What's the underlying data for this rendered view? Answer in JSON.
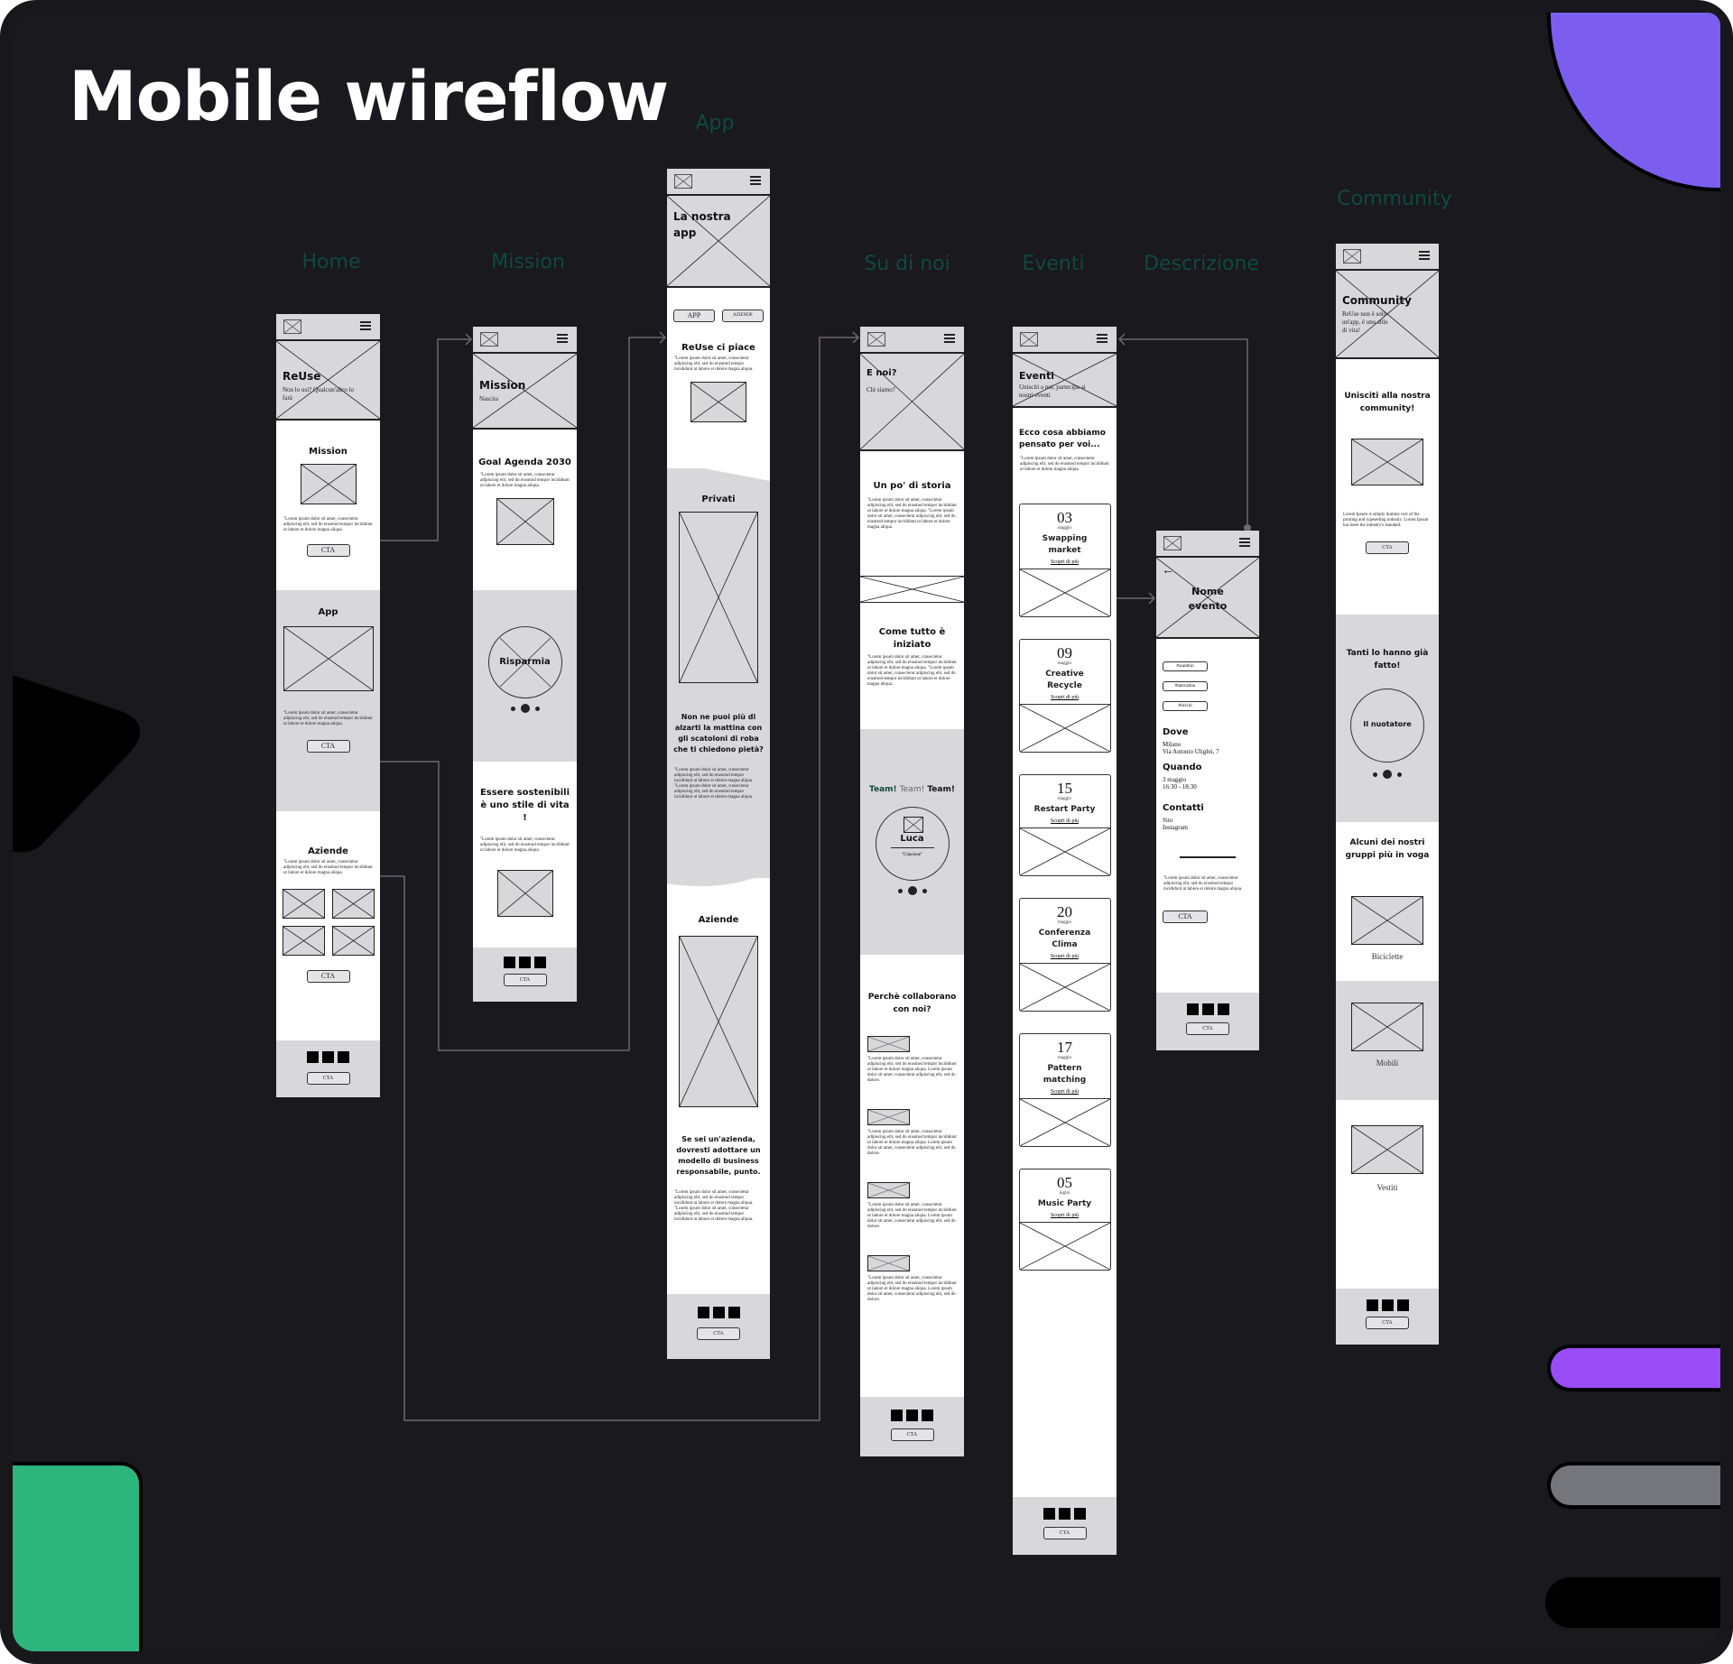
{
  "board": {
    "title": "Mobile wireflow",
    "colors": {
      "background": "#1a191d",
      "label": "#0f4a3c",
      "purple_corner": "#7b5ef0",
      "purple_pill": "#9a4cf6",
      "gray_pill": "#75767c",
      "green_block": "#2db57e"
    }
  },
  "flow_labels": {
    "home": "Home",
    "mission": "Mission",
    "app": "App",
    "su_di_noi": "Su di noi",
    "eventi": "Eventi",
    "descrizione": "Descrizione",
    "community": "Community"
  },
  "common": {
    "cta": "CTA",
    "lorem": "\"Lorem ipsum dolor sit amet, consectetur adipiscing elit, sed do eiusmod tempor incididunt ut labore et dolore magna aliqua.",
    "lorem_long": "\"Lorem ipsum dolor sit amet, consectetur adipiscing elit, sed do eiusmod tempor incididunt ut labore et dolore magna aliqua. \"Lorem ipsum dolor sit amet, consectetur adipiscing elit, sed do eiusmod tempor incididunt ut labore et dolore magna aliqua.",
    "lorem_collab": "\"Lorem ipsum dolor sit amet, consectetur adipiscing elit, sed do eiusmod tempor incididunt ut labore et dolore magna aliqua. Lorem ipsum dolor sit amet, consectetur adipiscing elit, sed do dolore.",
    "lorem_industry": "Lorem Ipsum is simply dummy text of the printing and typesetting industry. Lorem Ipsum has been the industry's standard."
  },
  "home": {
    "hero_title": "ReUse",
    "hero_sub": "Non lo usi? Qualcun'altro lo farà",
    "mission_title": "Mission",
    "app_title": "App",
    "aziende_title": "Aziende"
  },
  "mission": {
    "hero_title": "Mission",
    "hero_sub": "Nascita",
    "goal_title": "Goal Agenda 2030",
    "carousel_label": "Risparmia",
    "sustain_title": "Essere sostenibili è uno stile di vita !"
  },
  "app": {
    "hero_title": "La nostra app",
    "tabs": [
      "APP",
      "AZIENDE"
    ],
    "reuse_title": "ReUse ci piace",
    "privati_title": "Privati",
    "privati_question": "Non ne puoi più di alzarti la mattina con gli scatoloni di roba che ti chiedono pietà?",
    "aziende_title": "Aziende",
    "aziende_statement": "Se sei un'azienda, dovresti adottare un modello di business responsabile, punto."
  },
  "su_di_noi": {
    "hero_title": "E noi?",
    "hero_sub": "Chi siamo?",
    "storia_title": "Un po' di storia",
    "iniziato_title": "Come tutto è iniziato",
    "team_words": [
      "Team!",
      "Team!",
      "Team!"
    ],
    "team_member": "Luca",
    "team_quote": "\"Citazione\"",
    "collab_title": "Perchè collaborano con noi?"
  },
  "eventi": {
    "hero_title": "Eventi",
    "hero_sub": "Unisciti a noi, partecipa ai nostri eventi",
    "intro_title": "Ecco cosa abbiamo pensato per voi...",
    "more_link": "Scopri di più",
    "events": [
      {
        "day": "03",
        "month": "maggio",
        "name": "Swapping market"
      },
      {
        "day": "09",
        "month": "maggio",
        "name": "Creative Recycle"
      },
      {
        "day": "15",
        "month": "maggio",
        "name": "Restart Party"
      },
      {
        "day": "20",
        "month": "maggio",
        "name": "Conferenza Clima"
      },
      {
        "day": "17",
        "month": "maggio",
        "name": "Pattern matching"
      },
      {
        "day": "05",
        "month": "luglio",
        "name": "Music Party"
      }
    ]
  },
  "descrizione": {
    "hero_title": "Nome evento",
    "tags": [
      "#scambio",
      "#mercatino",
      "#riciclo"
    ],
    "dove_label": "Dove",
    "dove_value": [
      "Milano",
      "Via Antonio Uliglni, 7"
    ],
    "quando_label": "Quando",
    "quando_value": [
      "3 maggio",
      "16:30 - 18:30"
    ],
    "contatti_label": "Contatti",
    "contatti_value": [
      "Sito",
      "Instagram"
    ]
  },
  "community": {
    "hero_title": "Community",
    "hero_sub": "ReUse non è solo un'app, è uno stile di vita!",
    "join_title": "Unisciti alla nostra community!",
    "done_title": "Tanti lo hanno già fatto!",
    "carousel_label": "Il nuotatore",
    "groups_title": "Alcuni dei nostri gruppi più in voga",
    "groups": [
      "Biciclette",
      "Mobili",
      "Vestiti"
    ]
  }
}
